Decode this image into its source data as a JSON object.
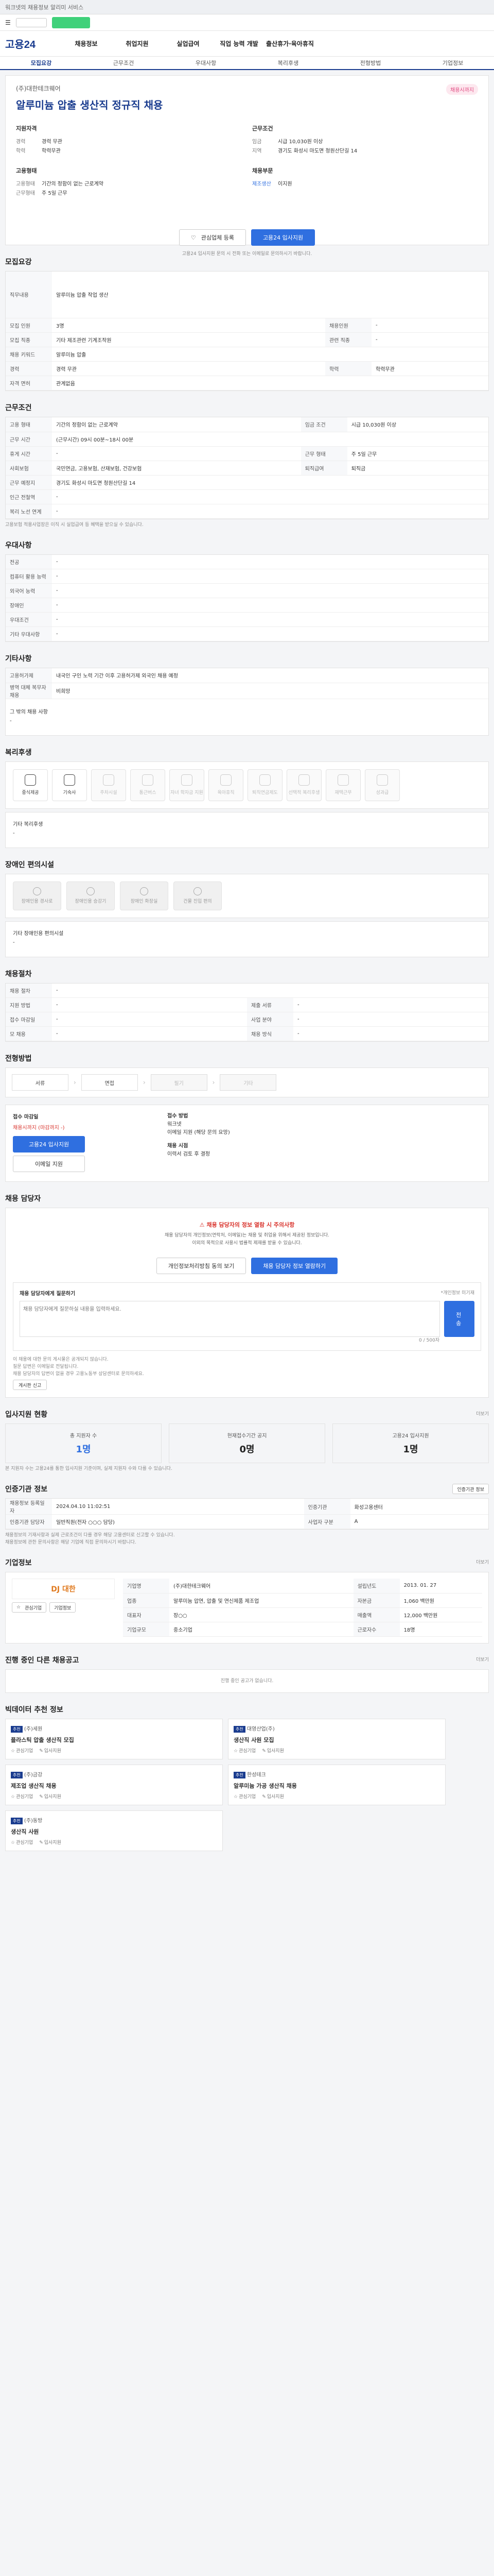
{
  "topbar": {
    "text": "워크넷의 채용정보 알리미 서비스"
  },
  "gnb": {
    "logo": "고용24",
    "items": [
      "채용정보",
      "취업지원",
      "실업급여",
      "직업 능력 개발",
      "출산휴가·육아휴직"
    ]
  },
  "tabs": [
    "모집요강",
    "근무조건",
    "우대사항",
    "복리후생",
    "전형방법",
    "기업정보"
  ],
  "job": {
    "company": "(주)대한테크웨어",
    "badge": "채용시까지",
    "title": "알루미늄 압출 생산직 정규직 채용",
    "left": {
      "heading": "지원자격",
      "rows": [
        {
          "k": "경력",
          "v": "경력 무관"
        },
        {
          "k": "학력",
          "v": "학력무관"
        }
      ],
      "heading2": "고용형태",
      "rows2": [
        {
          "k": "고용형태",
          "v": "기간의 정함이 없는 근로계약"
        },
        {
          "k": "근무형태",
          "v": "주 5일 근무"
        }
      ]
    },
    "right": {
      "heading": "근무조건",
      "rows": [
        {
          "k": "임금",
          "v": "시급 10,030원 이상"
        },
        {
          "k": "지역",
          "v": "경기도 화성시 마도면 청원산단길 14"
        }
      ],
      "heading2": "채용부문",
      "tag1": "제조생산",
      "tag2": "이지원"
    },
    "btn_fav": "관심업체 등록",
    "btn_apply": "고용24 입사지원",
    "note": "고용24 입사지원 문의 시 전화 또는 이메일로 문의하시기 바랍니다."
  },
  "recruit": {
    "title": "모집요강",
    "duty_label": "직무내용",
    "duty": "알루미늄 압출 작업 생산",
    "rows": [
      [
        "모집 인원",
        "3명",
        "채용인원",
        "-"
      ],
      [
        "모집 직종",
        "기타 제조관련 기계조작원",
        "관련 직종",
        "-"
      ],
      [
        "채용 키워드",
        "알루미늄 압출",
        "",
        ""
      ],
      [
        "경력",
        "경력 무관",
        "학력",
        "학력무관"
      ],
      [
        "자격 면허",
        "관계없음",
        "",
        ""
      ]
    ]
  },
  "work": {
    "title": "근무조건",
    "rows": [
      [
        "고용 형태",
        "기간의 정함이 없는 근로계약",
        "임금 조건",
        "시급 10,030원 이상"
      ],
      [
        "근무 시간",
        "(근무시간) 09시 00분~18시 00분",
        "",
        ""
      ],
      [
        "휴게 시간",
        "-",
        "근무 형태",
        "주 5일 근무"
      ],
      [
        "사회보험",
        "국민연금, 고용보험, 산재보험, 건강보험",
        "퇴직급여",
        "퇴직금"
      ],
      [
        "근무 예정지",
        "경기도 화성시 마도면 청원산단길 14",
        "",
        ""
      ],
      [
        "인근 전철역",
        "-",
        "",
        ""
      ],
      [
        "복리 노선 연계",
        "-",
        "",
        ""
      ]
    ],
    "note": "고용보험 적용사업장은 이직 시 실업급여 등 혜택을 받으실 수 있습니다."
  },
  "pref": {
    "title": "우대사항",
    "rows": [
      [
        "전공",
        "-"
      ],
      [
        "컴퓨터 활용 능력",
        "-"
      ],
      [
        "외국어 능력",
        "-"
      ],
      [
        "장애인",
        "-"
      ],
      [
        "우대조건",
        "-"
      ],
      [
        "기타 우대사항",
        "-"
      ]
    ]
  },
  "etc": {
    "title": "기타사항",
    "rows": [
      [
        "고용허가제",
        "내국인 구인 노력 기간 이후 고용허가제 외국인 채용 예정"
      ],
      [
        "병역 대체 복무자 채용",
        "비희망"
      ]
    ],
    "caption": "그 밖의 채용 사항",
    "caption_v": "-"
  },
  "welfare": {
    "title": "복리후생",
    "items": [
      {
        "label": "중식제공",
        "on": true
      },
      {
        "label": "기숙사",
        "on": true
      },
      {
        "label": "주차시설",
        "on": false
      },
      {
        "label": "통근버스",
        "on": false
      },
      {
        "label": "자녀 학자금 지원",
        "on": false
      },
      {
        "label": "육아휴직",
        "on": false
      },
      {
        "label": "퇴직연금제도",
        "on": false
      },
      {
        "label": "선택적 복리후생",
        "on": false
      },
      {
        "label": "재택근무",
        "on": false
      },
      {
        "label": "성과급",
        "on": false
      }
    ],
    "etc_label": "기타 복리후생",
    "etc_value": "-"
  },
  "facility": {
    "title": "장애인 편의시설",
    "items": [
      "장애인용 경사로",
      "장애인용 승강기",
      "장애인 화장실",
      "건물 진입 편의"
    ],
    "etc_label": "기타 장애인용 편의시설",
    "etc_value": "-"
  },
  "screening": {
    "title": "채용절차",
    "rows": [
      [
        "채용 절차",
        "-",
        "",
        ""
      ],
      [
        "지원 방법",
        "-",
        "제출 서류",
        "-"
      ],
      [
        "접수 마감일",
        "-",
        "사업 분야",
        "-"
      ],
      [
        "모 채용",
        "-",
        "채용 방식",
        "-"
      ]
    ]
  },
  "process": {
    "title": "전형방법",
    "steps": [
      {
        "label": "서류",
        "on": true
      },
      {
        "label": "면접",
        "on": true
      },
      {
        "label": "필기",
        "on": false
      },
      {
        "label": "기타",
        "on": false
      }
    ]
  },
  "apply": {
    "left_label": "접수 마감일",
    "deadline": "채용시까지 (마감까지 -)",
    "btn1": "고용24 입사지원",
    "btn2": "이메일 지원",
    "right_label": "접수 방법",
    "methods": [
      "워크넷",
      "이메일 지원 (해당 문의 요망)"
    ],
    "result_label": "채용 시점",
    "result": "이력서 검토 후 결정"
  },
  "manager": {
    "title": "채용 담당자",
    "alert": "채용 담당자의 정보 열람 시 주의사항",
    "lines": [
      "채용 담당자의 개인정보(연락처, 이메일)는 채용 및 취업을 위해서 제공된 정보입니다.",
      "이외의 목적으로 사용시 법률적 제재를 받을 수 있습니다."
    ],
    "btn_agree": "개인정보처리방침 동의 보기",
    "btn_view": "채용 담당자 정보 열람하기",
    "question_title": "채용 담당자에게 질문하기",
    "question_note": "*개인정보 미기재",
    "placeholder": "채용 담당자에게 질문하실 내용을 입력하세요.",
    "counter": "0 / 500자",
    "submit": "전송",
    "notes": [
      "이 채용에 대한 문의 게시물은 공개되지 않습니다.",
      "질문 답변은 이메일로 전달됩니다.",
      "채용 담당자의 답변이 없을 경우 고용노동부 상담센터로 문의하세요."
    ],
    "report_btn": "게시판 신고"
  },
  "status": {
    "title": "입사지원 현황",
    "more": "더보기",
    "items": [
      {
        "label": "총 지원자 수",
        "value": "1명"
      },
      {
        "label": "현재접수기간 공지",
        "value": "0명"
      },
      {
        "label": "고용24 입사지원",
        "value": "1명"
      }
    ],
    "note": "본 지원자 수는 고용24를 통한 입사지원 기준이며, 실제 지원자 수와 다를 수 있습니다."
  },
  "org": {
    "title": "인증기관 정보",
    "btn": "인증기관 정보",
    "rows": [
      [
        "채용정보 등록일자",
        "2024.04.10 11:02:51",
        "인증기관",
        "화성고용센터"
      ],
      [
        "인증기관 담당자",
        "일반직원(전자 ○○○ 담당)",
        "사업자 구분",
        "A"
      ]
    ],
    "notes": [
      "채용정보의 기재사항과 실제 근로조건이 다를 경우 해당 고용센터로 신고할 수 있습니다.",
      "채용정보에 관한 문의사항은 해당 기업에 직접 문의하시기 바랍니다."
    ]
  },
  "company": {
    "title": "기업정보",
    "more": "더보기",
    "logo_text": "DJ 대한",
    "btn1": "관심기업",
    "btn2": "기업정보",
    "rows": [
      [
        "기업명",
        "(주)대한테크웨어",
        "설립년도",
        "2013. 01. 27"
      ],
      [
        "업종",
        "알루미늄 압연, 압출 및 연신제품 제조업",
        "자본금",
        "1,060 백만원"
      ],
      [
        "대표자",
        "장○○",
        "매출액",
        "12,000 백만원"
      ],
      [
        "기업규모",
        "중소기업",
        "근로자수",
        "18명"
      ]
    ]
  },
  "related": {
    "title": "진행 중인 다른 채용공고",
    "more": "더보기",
    "empty": "진행 중인 공고가 없습니다."
  },
  "sponsor": {
    "title": "빅데이터 추천 정보",
    "cards": [
      {
        "badge": "추천",
        "name": "(주)세원",
        "title": "플라스틱 압출 생산직 모집",
        "a1": "관심기업",
        "a2": "입사지원"
      },
      {
        "badge": "추천",
        "name": "대영산업(주)",
        "title": "생산직 사원 모집",
        "a1": "관심기업",
        "a2": "입사지원"
      },
      {
        "badge": "추천",
        "name": "(주)금강",
        "title": "제조업 생산직 채용",
        "a1": "관심기업",
        "a2": "입사지원"
      },
      {
        "badge": "추천",
        "name": "한성테크",
        "title": "알루미늄 가공 생산직 채용",
        "a1": "관심기업",
        "a2": "입사지원"
      },
      {
        "badge": "추천",
        "name": "(주)동방",
        "title": "생산직 사원",
        "a1": "관심기업",
        "a2": "입사지원"
      }
    ]
  }
}
